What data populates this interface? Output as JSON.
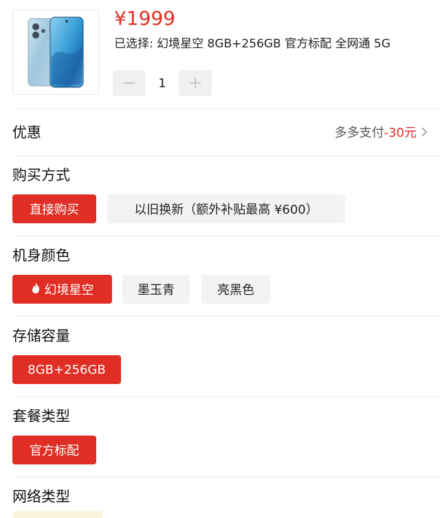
{
  "product": {
    "price": "¥1999",
    "selected_text": "已选择: 幻境星空 8GB+256GB 官方标配 全网通 5G",
    "quantity": "1",
    "minus_label": "−",
    "plus_label": "+"
  },
  "discount": {
    "label": "优惠",
    "value_prefix": "多多支付",
    "value_amount": "-30元"
  },
  "purchase_method": {
    "title": "购买方式",
    "options": [
      "直接购买",
      "以旧换新（额外补贴最高 ¥600）"
    ],
    "selected": "直接购买"
  },
  "color": {
    "title": "机身颜色",
    "options": [
      "幻境星空",
      "墨玉青",
      "亮黑色"
    ],
    "selected": "幻境星空"
  },
  "storage": {
    "title": "存储容量",
    "options": [
      "8GB+256GB"
    ],
    "selected": "8GB+256GB"
  },
  "package": {
    "title": "套餐类型",
    "options": [
      "官方标配"
    ],
    "selected": "官方标配"
  },
  "network": {
    "title": "网络类型"
  },
  "colors": {
    "accent": "#e02e24",
    "option_bg": "#f3f3f3"
  },
  "icons": [
    "phone-product-image",
    "minus-icon",
    "plus-icon",
    "chevron-right-icon",
    "flame-icon"
  ]
}
